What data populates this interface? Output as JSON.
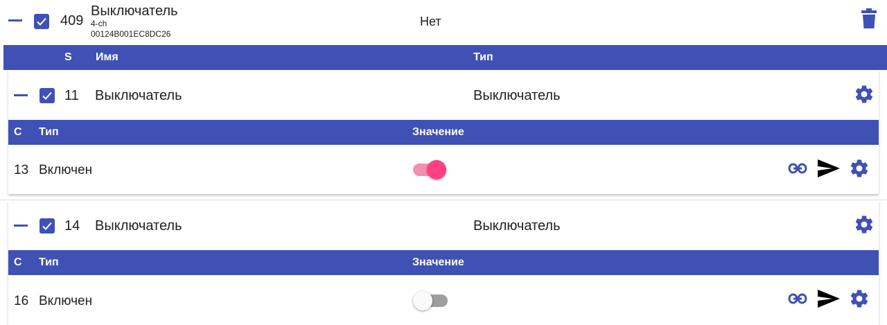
{
  "device": {
    "id": "409",
    "name": "Выключатель",
    "model": "4-ch",
    "address": "00124B001EC8DC26",
    "type": "Нет",
    "checked": true
  },
  "endpoint_header": {
    "s": "S",
    "name": "Имя",
    "type": "Тип"
  },
  "endpoints": [
    {
      "id": "11",
      "name": "Выключатель",
      "type": "Выключатель",
      "checked": true,
      "columns": {
        "c": "C",
        "type": "Тип",
        "value": "Значение"
      },
      "clusters": [
        {
          "id": "13",
          "type": "Включен",
          "value": true
        }
      ]
    },
    {
      "id": "14",
      "name": "Выключатель",
      "type": "Выключатель",
      "checked": true,
      "columns": {
        "c": "C",
        "type": "Тип",
        "value": "Значение"
      },
      "clusters": [
        {
          "id": "16",
          "type": "Включен",
          "value": false
        }
      ]
    }
  ],
  "icons": {
    "delete": "trash-icon",
    "settings": "gear-icon",
    "link": "link-icon",
    "send": "send-icon",
    "collapse": "minus-icon",
    "check": "check-icon"
  },
  "colors": {
    "primary": "#3f51b5",
    "accent": "#ff4081",
    "accent_track": "#f48fb1",
    "off_track": "#9e9e9e",
    "off_knob": "#fafafa"
  }
}
